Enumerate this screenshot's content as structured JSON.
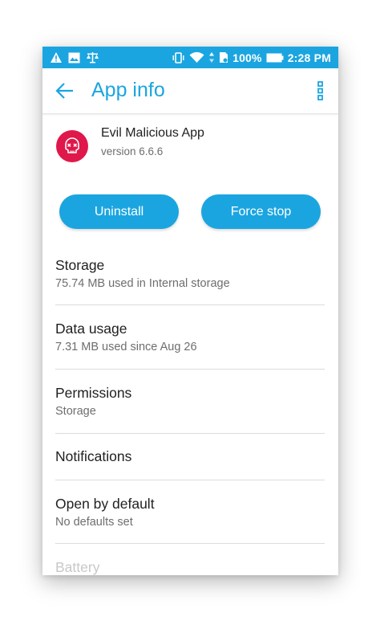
{
  "status_bar": {
    "left_icons": [
      "warning-icon",
      "image-icon",
      "scales-icon"
    ],
    "right_icons": [
      "vibrate-icon",
      "wifi-icon",
      "data-transfer-icon",
      "sim-card-icon"
    ],
    "battery_percent": "100%",
    "time": "2:28 PM",
    "color": "#1ba5e0"
  },
  "app_bar": {
    "title": "App info",
    "back_icon": "back-arrow-icon",
    "menu_icon": "overflow-menu-icon",
    "accent_color": "#1ba5e0"
  },
  "app": {
    "name": "Evil Malicious App",
    "version": "version 6.6.6",
    "icon": "skull-icon",
    "icon_color": "#e0174a"
  },
  "buttons": {
    "uninstall": "Uninstall",
    "force_stop": "Force stop"
  },
  "settings": [
    {
      "title": "Storage",
      "subtitle": "75.74 MB used in Internal storage"
    },
    {
      "title": "Data usage",
      "subtitle": "7.31 MB used since Aug 26"
    },
    {
      "title": "Permissions",
      "subtitle": "Storage"
    },
    {
      "title": "Notifications",
      "subtitle": ""
    },
    {
      "title": "Open by default",
      "subtitle": "No defaults set"
    },
    {
      "title": "Battery",
      "subtitle": ""
    }
  ]
}
